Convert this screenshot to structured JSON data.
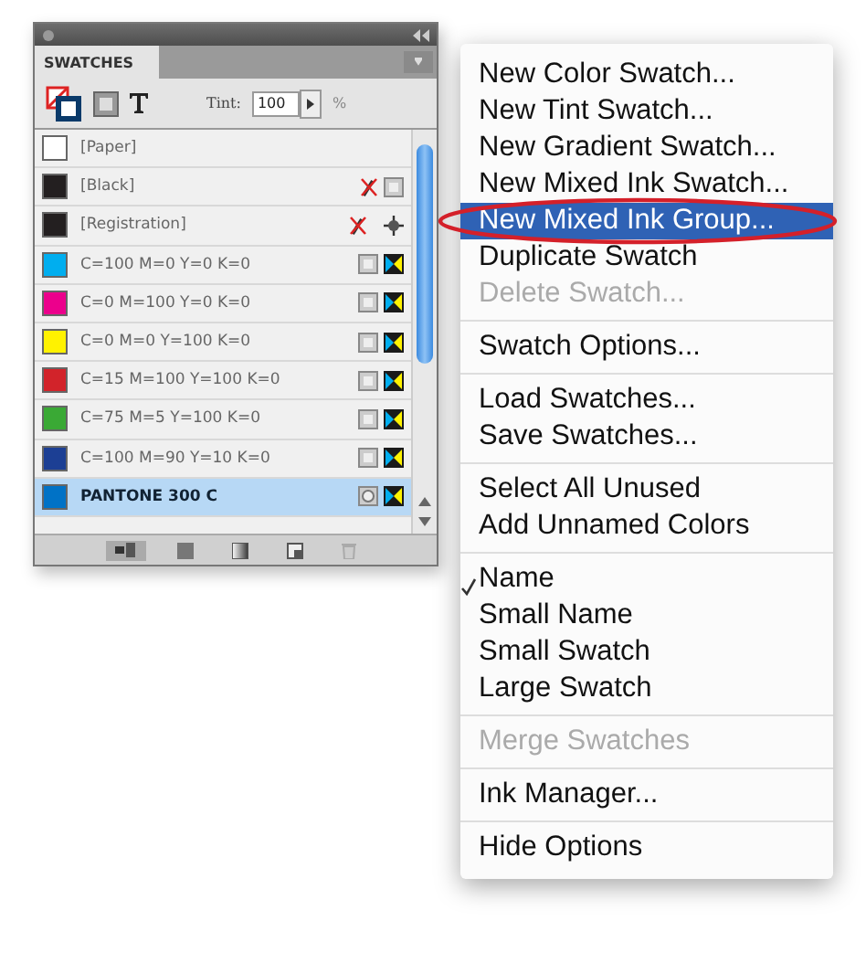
{
  "panel": {
    "title": "SWATCHES",
    "tint_label": "Tint:",
    "tint_value": "100",
    "percent": "%",
    "swatches": [
      {
        "name": "[Paper]",
        "color": "#ffffff",
        "kind": "paper",
        "selected": false
      },
      {
        "name": "[Black]",
        "color": "#231f20",
        "kind": "black",
        "selected": false
      },
      {
        "name": "[Registration]",
        "color": "#231f20",
        "kind": "registration",
        "selected": false
      },
      {
        "name": "C=100 M=0 Y=0 K=0",
        "color": "#00aeef",
        "kind": "process",
        "selected": false
      },
      {
        "name": "C=0 M=100 Y=0 K=0",
        "color": "#ec008c",
        "kind": "process",
        "selected": false
      },
      {
        "name": "C=0 M=0 Y=100 K=0",
        "color": "#fff200",
        "kind": "process",
        "selected": false
      },
      {
        "name": "C=15 M=100 Y=100 K=0",
        "color": "#d2232a",
        "kind": "process",
        "selected": false
      },
      {
        "name": "C=75 M=5 Y=100 K=0",
        "color": "#3aa935",
        "kind": "process",
        "selected": false
      },
      {
        "name": "C=100 M=90 Y=10 K=0",
        "color": "#1c3f94",
        "kind": "process",
        "selected": false
      },
      {
        "name": "PANTONE 300 C",
        "color": "#0072c6",
        "kind": "spot",
        "selected": true
      }
    ]
  },
  "menu": {
    "groups": [
      [
        {
          "label": "New Color Swatch...",
          "disabled": false,
          "selected": false,
          "checked": false,
          "annotated": false
        },
        {
          "label": "New Tint Swatch...",
          "disabled": false,
          "selected": false,
          "checked": false,
          "annotated": false
        },
        {
          "label": "New Gradient Swatch...",
          "disabled": false,
          "selected": false,
          "checked": false,
          "annotated": false
        },
        {
          "label": "New Mixed Ink Swatch...",
          "disabled": false,
          "selected": false,
          "checked": false,
          "annotated": false
        },
        {
          "label": "New Mixed Ink Group...",
          "disabled": false,
          "selected": true,
          "checked": false,
          "annotated": true
        },
        {
          "label": "Duplicate Swatch",
          "disabled": false,
          "selected": false,
          "checked": false,
          "annotated": false
        },
        {
          "label": "Delete Swatch...",
          "disabled": true,
          "selected": false,
          "checked": false,
          "annotated": false
        }
      ],
      [
        {
          "label": "Swatch Options...",
          "disabled": false,
          "selected": false,
          "checked": false,
          "annotated": false
        }
      ],
      [
        {
          "label": "Load Swatches...",
          "disabled": false,
          "selected": false,
          "checked": false,
          "annotated": false
        },
        {
          "label": "Save Swatches...",
          "disabled": false,
          "selected": false,
          "checked": false,
          "annotated": false
        }
      ],
      [
        {
          "label": "Select All Unused",
          "disabled": false,
          "selected": false,
          "checked": false,
          "annotated": false
        },
        {
          "label": "Add Unnamed Colors",
          "disabled": false,
          "selected": false,
          "checked": false,
          "annotated": false
        }
      ],
      [
        {
          "label": "Name",
          "disabled": false,
          "selected": false,
          "checked": true,
          "annotated": false
        },
        {
          "label": "Small Name",
          "disabled": false,
          "selected": false,
          "checked": false,
          "annotated": false
        },
        {
          "label": "Small Swatch",
          "disabled": false,
          "selected": false,
          "checked": false,
          "annotated": false
        },
        {
          "label": "Large Swatch",
          "disabled": false,
          "selected": false,
          "checked": false,
          "annotated": false
        }
      ],
      [
        {
          "label": "Merge Swatches",
          "disabled": true,
          "selected": false,
          "checked": false,
          "annotated": false
        }
      ],
      [
        {
          "label": "Ink Manager...",
          "disabled": false,
          "selected": false,
          "checked": false,
          "annotated": false
        }
      ],
      [
        {
          "label": "Hide Options",
          "disabled": false,
          "selected": false,
          "checked": false,
          "annotated": false
        }
      ]
    ]
  }
}
